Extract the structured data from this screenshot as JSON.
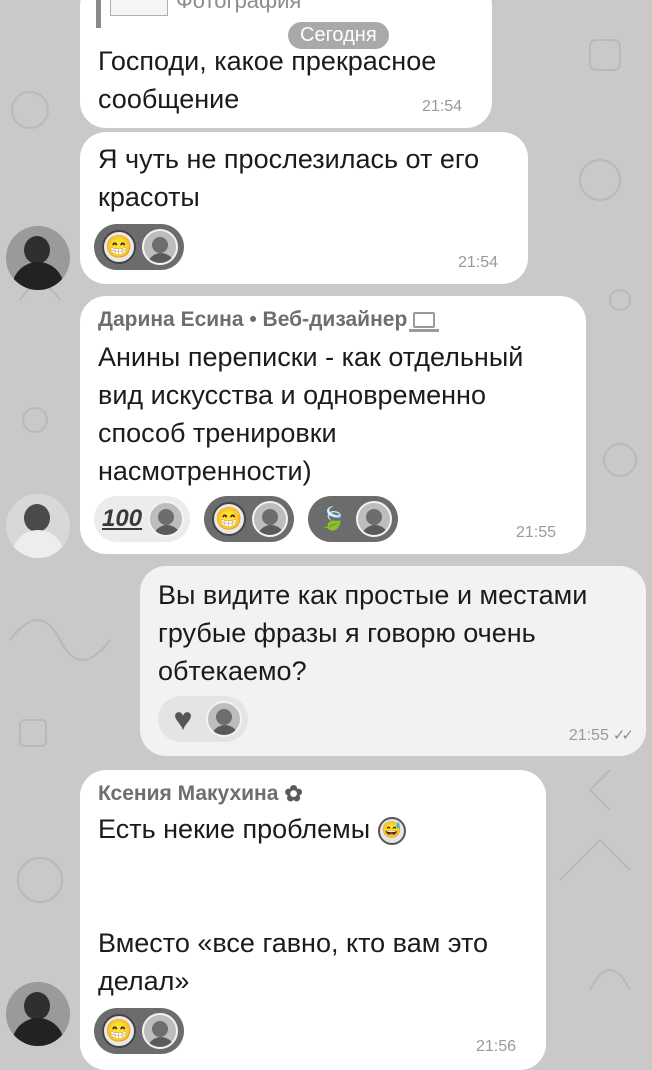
{
  "date_divider": "Сегодня",
  "reply_preview": {
    "label": "Фотография"
  },
  "messages": [
    {
      "text": "Господи, какое прекрасное\nсообщение",
      "time": "21:54"
    },
    {
      "text": "Я чуть не прослезилась от его\nкрасоты",
      "time": "21:54",
      "reactions": [
        {
          "emoji": "😁"
        }
      ]
    },
    {
      "sender": "Дарина Есина • Веб-дизайнер",
      "text": "Анины переписки - как отдельный\nвид искусства и одновременно\nспособ тренировки\nнасмотренности)",
      "time": "21:55",
      "reactions": [
        {
          "emoji": "💯"
        },
        {
          "emoji": "😁"
        },
        {
          "emoji": "🍃"
        }
      ]
    },
    {
      "text": "Вы видите как простые и местами\nгрубые фразы я говорю очень\nобтекаемо?",
      "time": "21:55",
      "reactions": [
        {
          "emoji": "♥"
        }
      ]
    },
    {
      "sender": "Ксения Макухина",
      "text": "Есть некие проблемы",
      "text2": "Вместо «все гавно, кто вам это\nделал»",
      "time": "21:56",
      "reactions": [
        {
          "emoji": "😁"
        }
      ]
    }
  ],
  "icons": {
    "emoji_100": "100",
    "sent_check": "✓✓",
    "inline_grin": "😅"
  }
}
